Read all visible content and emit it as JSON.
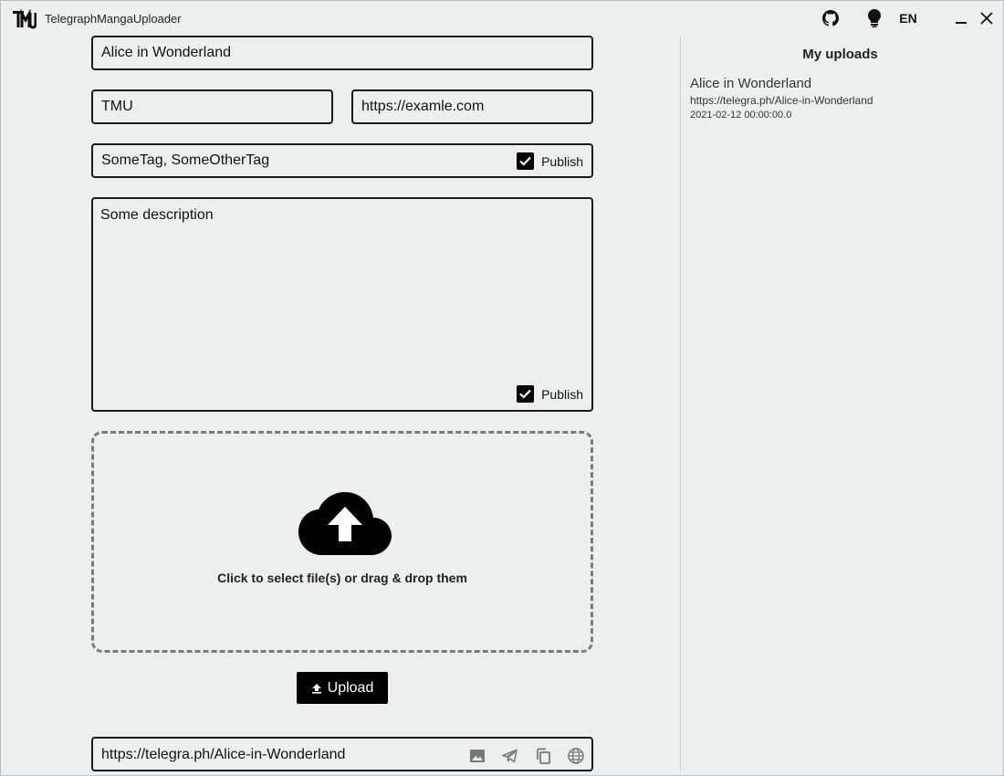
{
  "window": {
    "title": "TelegraphMangaUploader",
    "language": "EN"
  },
  "form": {
    "title_value": "Alice in Wonderland",
    "author_value": "TMU",
    "author_url_value": "https://examle.com",
    "tags_value": "SomeTag, SomeOtherTag",
    "tags_publish_label": "Publish",
    "tags_publish_checked": true,
    "description_value": "Some description",
    "description_publish_label": "Publish",
    "description_publish_checked": true
  },
  "dropzone": {
    "text": "Click to select file(s) or drag & drop them",
    "icon": "cloud-upload-icon"
  },
  "upload_button": {
    "label": "Upload",
    "icon": "upload-icon"
  },
  "result": {
    "url": "https://telegra.ph/Alice-in-Wonderland",
    "icons": [
      "image-icon",
      "telegram-icon",
      "copy-icon",
      "globe-icon"
    ]
  },
  "uploads_panel": {
    "heading": "My uploads",
    "items": [
      {
        "title": "Alice in Wonderland",
        "url": "https://telegra.ph/Alice-in-Wonderland",
        "date": "2021-02-12 00:00:00.0"
      }
    ]
  },
  "colors": {
    "background": "#eceff0",
    "border": "#1a1a1a",
    "button": "#000000",
    "dropzone_border": "#7a7a7a"
  }
}
